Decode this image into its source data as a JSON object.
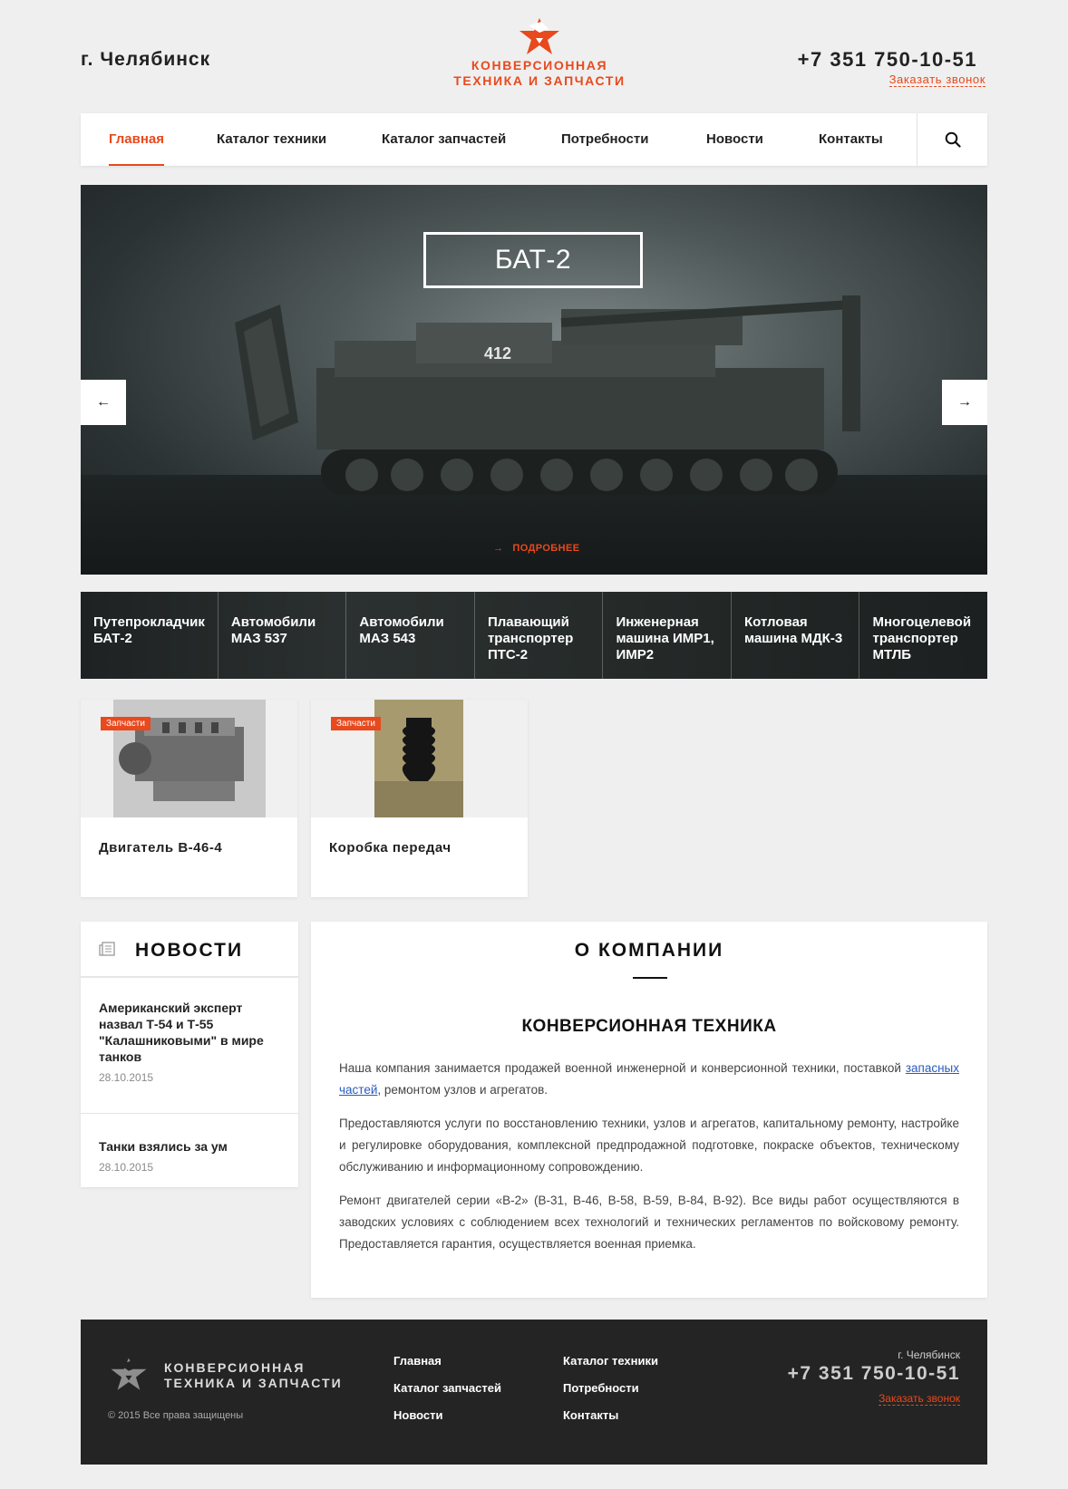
{
  "header": {
    "city": "г. Челябинск",
    "logo_line1": "Конверсионная",
    "logo_line2": "техника и запчасти",
    "phone": "+7 351 750-10-51",
    "callback": "Заказать звонок"
  },
  "nav": {
    "items": [
      {
        "label": "Главная",
        "active": true
      },
      {
        "label": "Каталог техники"
      },
      {
        "label": "Каталог запчастей"
      },
      {
        "label": "Потребности"
      },
      {
        "label": "Новости"
      },
      {
        "label": "Контакты"
      }
    ],
    "search_icon": "search-icon"
  },
  "slider": {
    "title": "БАТ-2",
    "vehicle_number": "412",
    "more": "ПОДРОБНЕЕ",
    "prev": "←",
    "next": "→"
  },
  "categories": [
    "Путепрокладчик БАТ-2",
    "Автомобили МАЗ 537",
    "Автомобили МАЗ 543",
    "Плавающий транспортер ПТС-2",
    "Инженерная машина ИМР1, ИМР2",
    "Котловая машина МДК-3",
    "Многоцелевой транспортер МТЛБ"
  ],
  "products": [
    {
      "tag": "Запчасти",
      "name": "Двигатель В-46-4"
    },
    {
      "tag": "Запчасти",
      "name": "Коробка передач"
    }
  ],
  "news": {
    "title": "НОВОСТИ",
    "items": [
      {
        "title": "Американский эксперт назвал Т-54 и Т-55 \"Калашниковыми\" в мире танков",
        "date": "28.10.2015"
      },
      {
        "title": "Танки взялись за ум",
        "date": "28.10.2015"
      }
    ]
  },
  "about": {
    "title": "О КОМПАНИИ",
    "subtitle": "КОНВЕРСИОННАЯ ТЕХНИКА",
    "p1_before": "Наша компания занимается продажей военной инженерной и конверсионной техники, поставкой ",
    "p1_link": "запасных частей",
    "p1_after": ", ремонтом узлов и агрегатов.",
    "p2": "  Предоставляются услуги по восстановлению техники, узлов и агрегатов, капитальному ремонту, настройке и регулировке оборудования, комплексной предпродажной подготовке, покраске объектов, техническому обслуживанию и информационному сопровождению.",
    "p3": "  Ремонт двигателей серии «В-2» (В-31, В-46, В-58, В-59, В-84, В-92). Все виды работ осуществляются в заводских условиях с соблюдением всех технологий и технических регламентов по войсковому ремонту. Предоставляется гарантия, осуществляется военная приемка."
  },
  "footer": {
    "logo_line1": "Конверсионная",
    "logo_line2": "техника и запчасти",
    "copyright": "© 2015 Все права защищены",
    "links": [
      "Главная",
      "Каталог техники",
      "Каталог запчастей",
      "Потребности",
      "Новости",
      "Контакты"
    ],
    "city": "г. Челябинск",
    "phone": "+7 351 750-10-51",
    "callback": "Заказать звонок"
  },
  "colors": {
    "accent": "#e8491d",
    "footer_bg": "#242424",
    "page_bg": "#efefef"
  }
}
